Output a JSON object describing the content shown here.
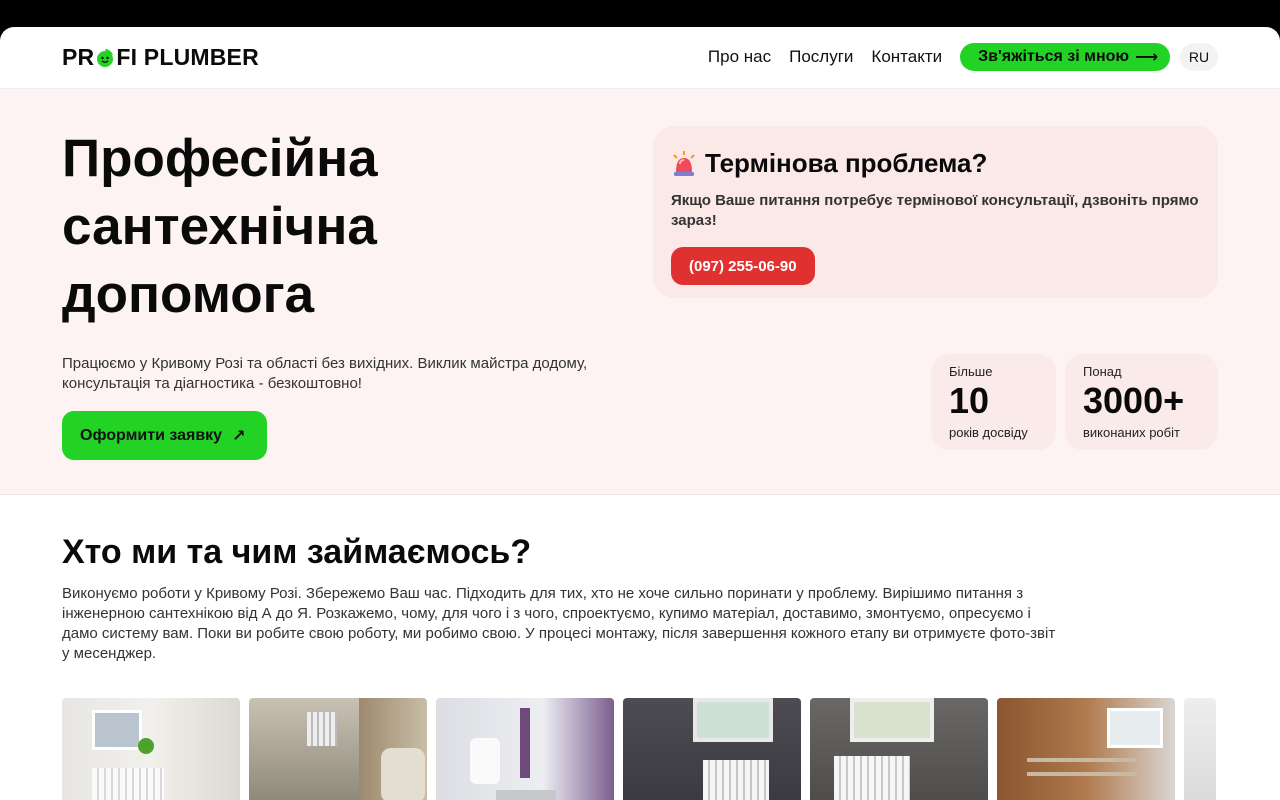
{
  "header": {
    "logo_text_left": "PR",
    "logo_text_right": "FI PLUMBER",
    "nav": [
      "Про нас",
      "Послуги",
      "Контакти"
    ],
    "cta_label": "Зв'яжіться зі мною",
    "lang": "RU"
  },
  "hero": {
    "title": "Професійна сантехнічна допомога",
    "subtitle": "Працюємо у Кривому Розі та області без вихідних. Виклик майстра додому, консультація та діагностика - безкоштовно!",
    "button_label": "Оформити заявку",
    "urgent": {
      "title": "Термінова проблема?",
      "text": "Якщо Ваше питання потребує термінової консультації, дзвоніть прямо зараз!",
      "phone": "(097) 255-06-90"
    },
    "stats": [
      {
        "small": "Більше",
        "big": "10",
        "caption": "років досвіду"
      },
      {
        "small": "Понад",
        "big": "3000+",
        "caption": "виконаних робіт"
      }
    ]
  },
  "about": {
    "title": "Хто ми та чим займаємось?",
    "text": "Виконуємо роботи у Кривому Розі. Збережемо Ваш час. Підходить для тих, хто не хоче сильно поринати у проблему. Вирішимо питання з інженерною сантехнікою від А до Я. Розкажемо, чому, для чого і з чого, спроектуємо, купимо матеріал, доставимо, змонтуємо, опресуємо і дамо систему вам. Поки ви робите свою роботу, ми робимо свою. У процесі монтажу, після завершення кожного етапу ви отримуєте фото-звіт у месенджер."
  },
  "colors": {
    "accent_green": "#22d326",
    "urgent_red": "#e03131",
    "hero_bg": "#fdf3f2"
  }
}
